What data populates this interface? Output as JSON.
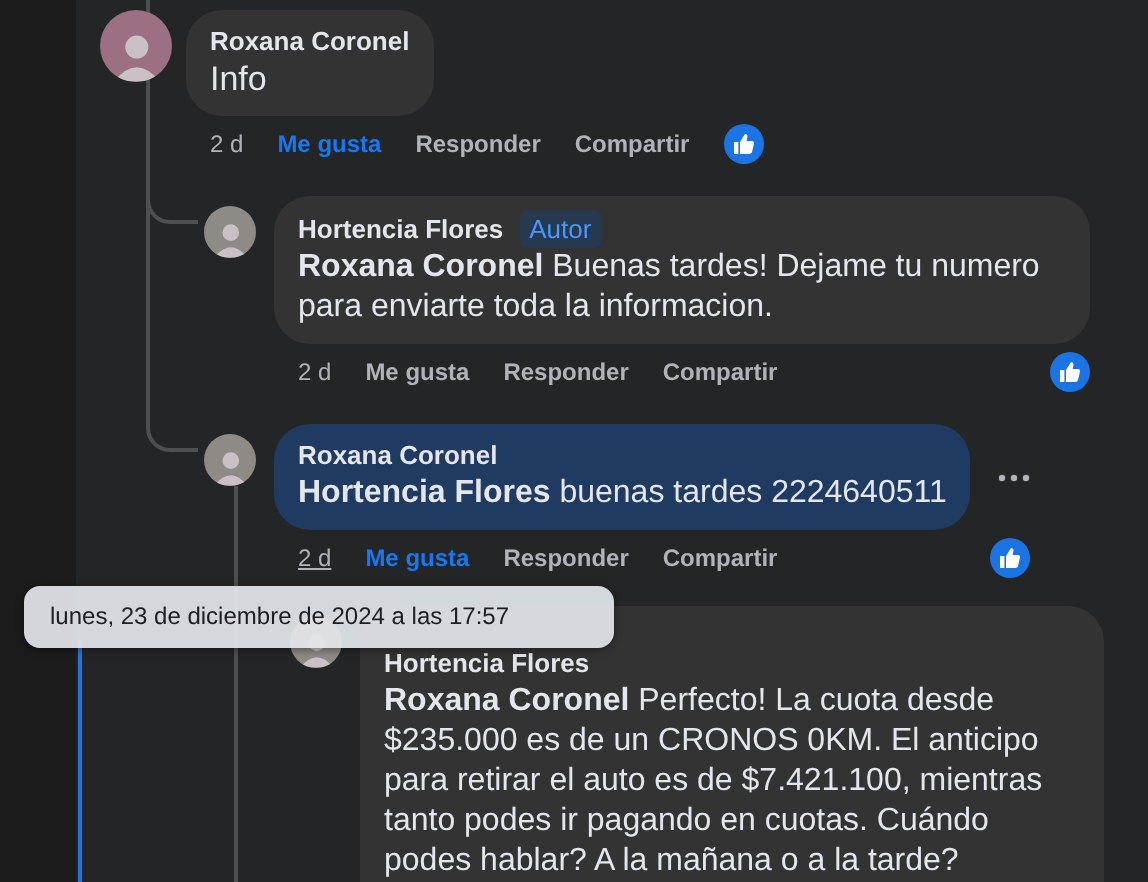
{
  "comments": [
    {
      "author": "Roxana Coronel",
      "text": "Info",
      "highlighted": false,
      "menu": false,
      "actions": {
        "time": "2 d",
        "time_hovered": false,
        "like": "Me gusta",
        "liked": true,
        "reply": "Responder",
        "share": "Compartir"
      },
      "children": [
        {
          "author": "Hortencia Flores",
          "badge": "Autor",
          "text": "**Roxana Coronel** Buenas tardes! Dejame tu numero para enviarte toda la informacion.",
          "highlighted": false,
          "menu": false,
          "actions": {
            "time": "2 d",
            "time_hovered": false,
            "like": "Me gusta",
            "liked": false,
            "reply": "Responder",
            "share": "Compartir"
          }
        },
        {
          "author": "Roxana Coronel",
          "text": "**Hortencia Flores** buenas tardes 2224640511",
          "highlighted": true,
          "menu": true,
          "actions": {
            "time": "2 d",
            "time_hovered": true,
            "like": "Me gusta",
            "liked": true,
            "reply": "Responder",
            "share": "Compartir"
          },
          "children": [
            {
              "author": "Hortencia Flores",
              "text": "**Roxana Coronel** Perfecto! La cuota desde $235.000 es de un CRONOS 0KM. El anticipo para retirar el auto es de $7.421.100, mientras tanto podes ir pagando en cuotas. Cuándo podes hablar? A la mañana o a la tarde?",
              "highlighted": false,
              "menu": false
            }
          ]
        }
      ]
    }
  ],
  "tooltip": {
    "text": "lunes, 23 de diciembre de 2024 a las 17:57"
  }
}
